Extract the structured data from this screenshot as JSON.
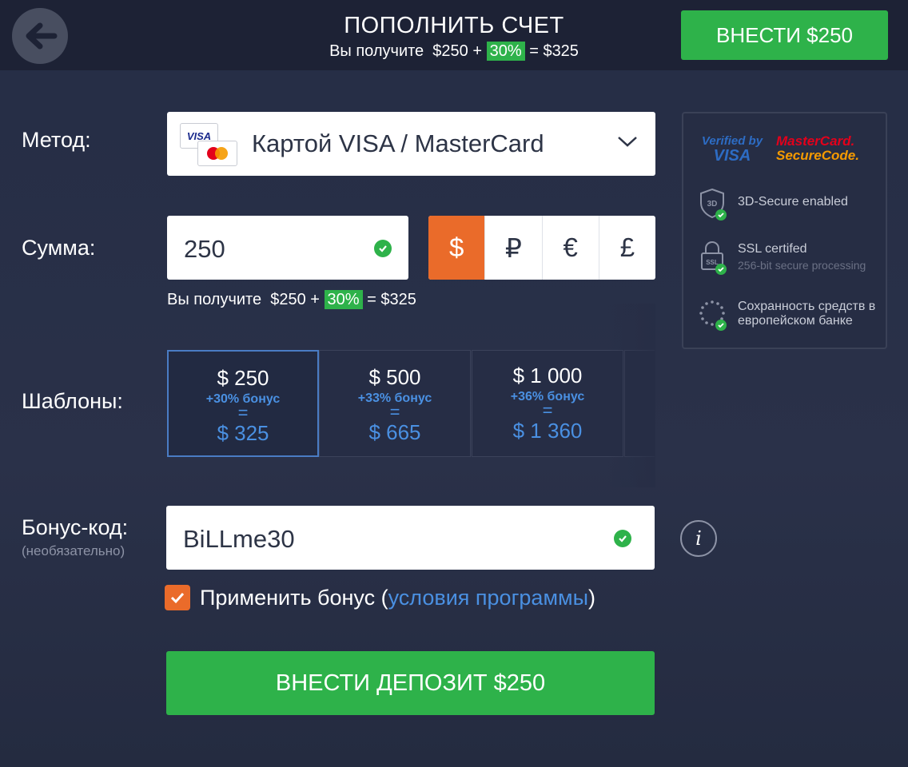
{
  "header": {
    "title": "ПОПОЛНИТЬ СЧЕТ",
    "subtitle": {
      "prefix": "Вы получите",
      "amount": "$250",
      "plus": "+",
      "percent": "30%",
      "equals": "= $325"
    },
    "action_label": "ВНЕСТИ $250"
  },
  "form": {
    "method": {
      "label": "Метод:",
      "value": "Картой VISA / MasterCard",
      "card_visa": "VISA"
    },
    "amount": {
      "label": "Сумма:",
      "value": "250"
    },
    "currencies": [
      {
        "symbol": "$",
        "active": true
      },
      {
        "symbol": "₽",
        "active": false
      },
      {
        "symbol": "€",
        "active": false
      },
      {
        "symbol": "£",
        "active": false
      }
    ],
    "receive": {
      "prefix": "Вы получите",
      "amount": "$250",
      "plus": "+",
      "percent": "30%",
      "equals": "= $325"
    },
    "templates": {
      "label": "Шаблоны:",
      "items": [
        {
          "amount": "$ 250",
          "bonus": "+30% бонус",
          "eq": "=",
          "total": "$ 325",
          "active": true
        },
        {
          "amount": "$ 500",
          "bonus": "+33% бонус",
          "eq": "=",
          "total": "$ 665",
          "active": false
        },
        {
          "amount": "$ 1 000",
          "bonus": "+36% бонус",
          "eq": "=",
          "total": "$ 1 360",
          "active": false
        }
      ]
    },
    "bonus_code": {
      "label": "Бонус-код:",
      "sublabel": "(необязательно)",
      "value": "BiLLme30",
      "info": "i"
    },
    "apply_bonus": {
      "checked": true,
      "text": "Применить бонус (",
      "link": "условия программы",
      "close": ")"
    },
    "submit_label": "ВНЕСТИ ДЕПОЗИТ $250"
  },
  "security": {
    "verified_visa": {
      "line1": "Verified by",
      "line2": "VISA"
    },
    "mastercard": {
      "line1": "MasterCard.",
      "line2": "SecureCode."
    },
    "items": [
      {
        "title": "3D-Secure enabled",
        "sub": "",
        "icon": "shield-3d-icon",
        "badge": "3D"
      },
      {
        "title": "SSL certifed",
        "sub": "256-bit secure processing",
        "icon": "lock-ssl-icon",
        "badge": "SSL"
      },
      {
        "title": "Сохранность средств в европейском банке",
        "sub": "",
        "icon": "eu-stars-icon"
      }
    ]
  },
  "colors": {
    "green": "#2eb24a",
    "orange": "#ea6b2a",
    "blue": "#4a90e2",
    "background": "#262d45"
  }
}
